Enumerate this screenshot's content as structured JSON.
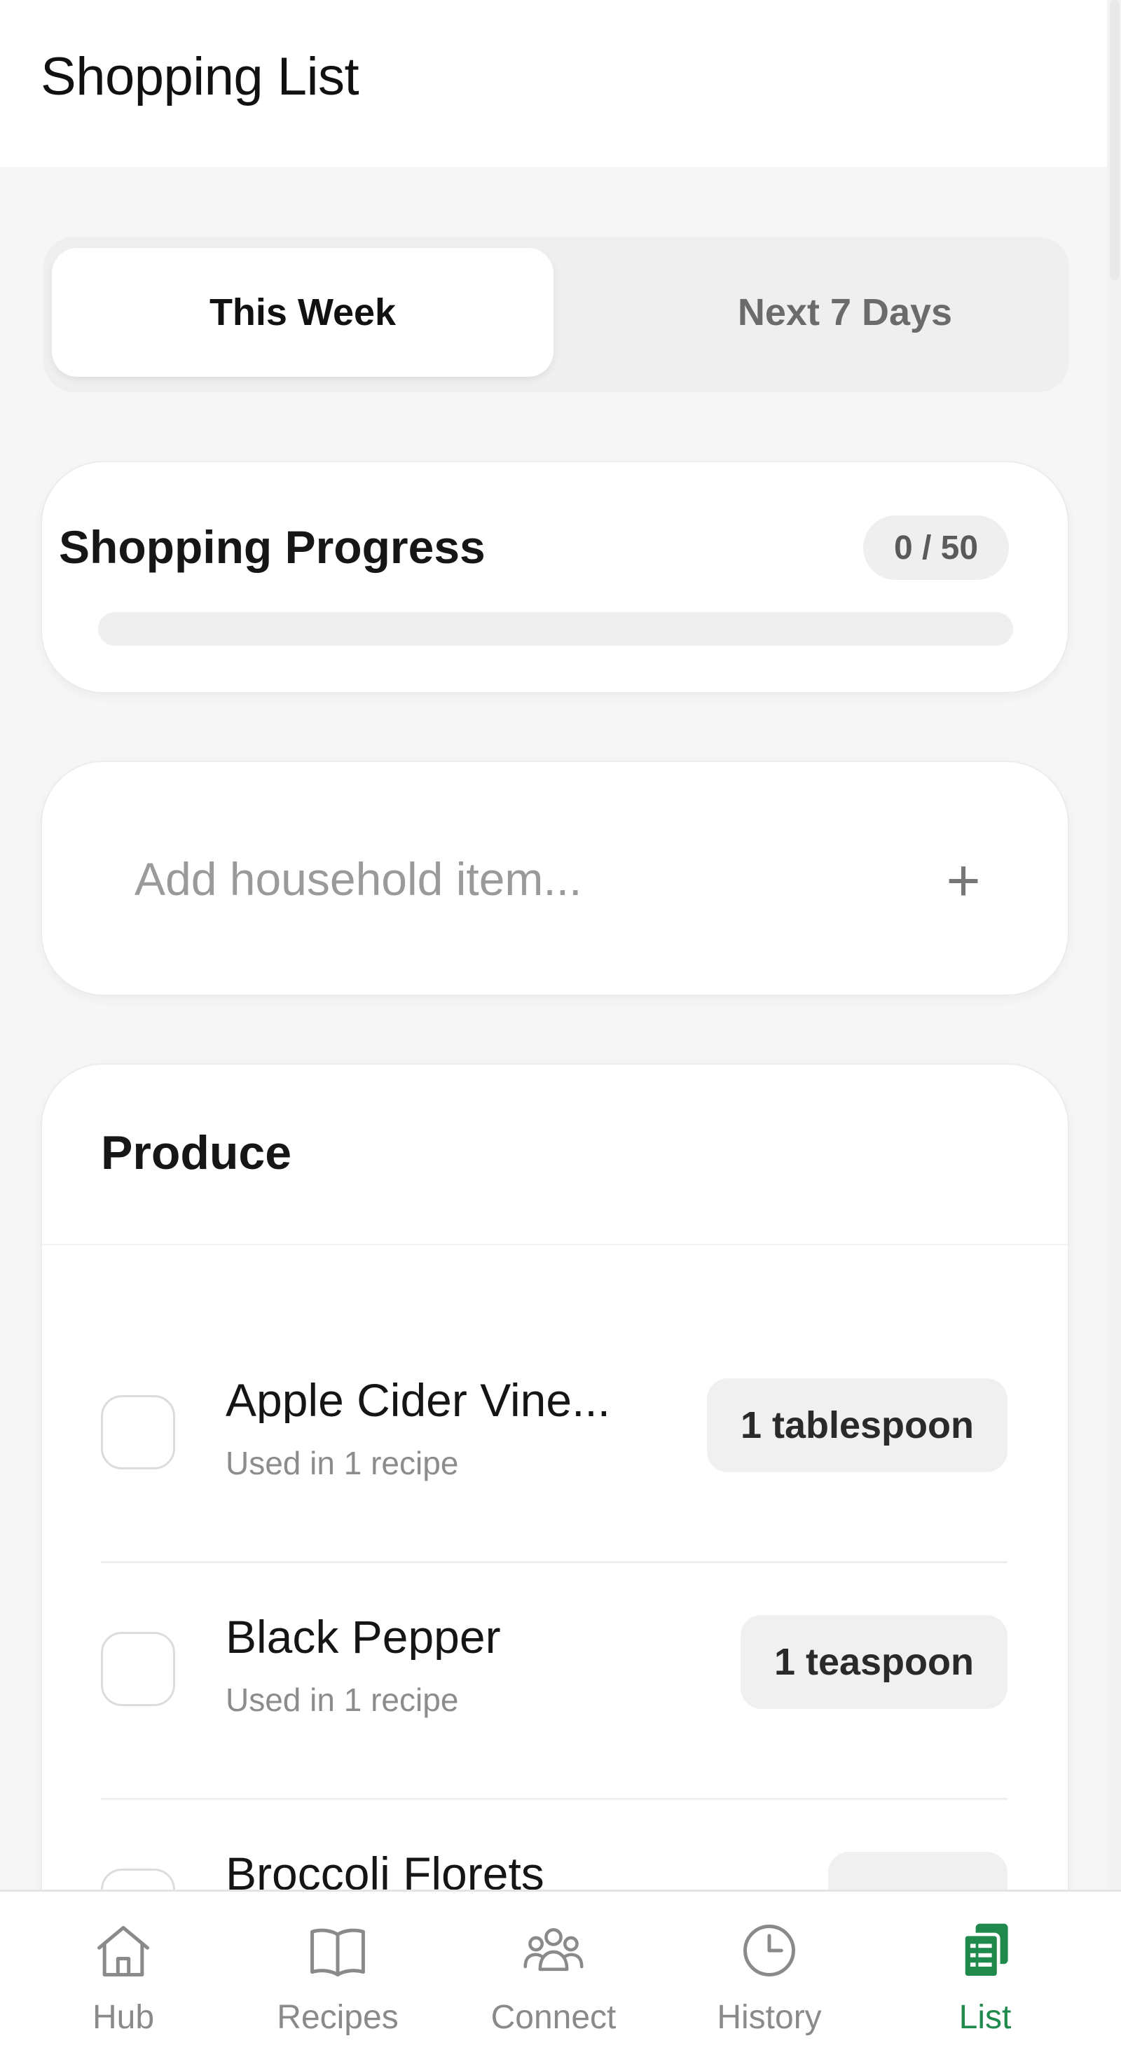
{
  "header": {
    "title": "Shopping List"
  },
  "tabs": [
    {
      "label": "This Week",
      "active": true
    },
    {
      "label": "Next 7 Days",
      "active": false
    }
  ],
  "progress": {
    "title": "Shopping Progress",
    "count_text": "0 / 50",
    "checked": 0,
    "total": 50
  },
  "add_item": {
    "placeholder": "Add household item...",
    "add_icon": "plus-icon"
  },
  "category": {
    "title": "Produce",
    "items": [
      {
        "name": "Apple Cider Vine...",
        "sub": "Used in 1 recipe",
        "qty": "1 tablespoon",
        "checked": false
      },
      {
        "name": "Black Pepper",
        "sub": "Used in 1 recipe",
        "qty": "1 teaspoon",
        "checked": false
      },
      {
        "name": "Broccoli Florets",
        "sub": "",
        "qty": "",
        "checked": false
      }
    ]
  },
  "nav": [
    {
      "label": "Hub",
      "icon": "home-icon",
      "active": false
    },
    {
      "label": "Recipes",
      "icon": "book-icon",
      "active": false
    },
    {
      "label": "Connect",
      "icon": "people-icon",
      "active": false
    },
    {
      "label": "History",
      "icon": "clock-icon",
      "active": false
    },
    {
      "label": "List",
      "icon": "list-icon",
      "active": true
    }
  ],
  "colors": {
    "accent": "#1f8a4c",
    "background": "#f6f6f6",
    "inactive": "#8a8a8a"
  }
}
